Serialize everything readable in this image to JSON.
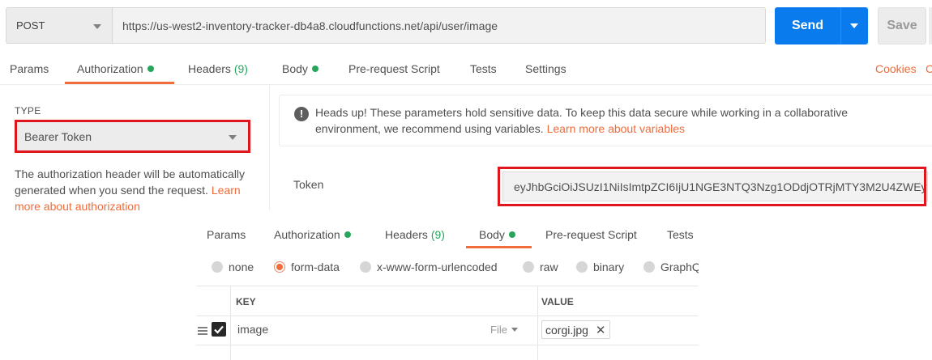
{
  "request": {
    "method": "POST",
    "url": "https://us-west2-inventory-tracker-db4a8.cloudfunctions.net/api/user/image",
    "send_label": "Send",
    "save_label": "Save"
  },
  "tabs": [
    {
      "label": "Params"
    },
    {
      "label": "Authorization",
      "dot": true,
      "active": true
    },
    {
      "label": "Headers",
      "count": "(9)"
    },
    {
      "label": "Body",
      "dot": true
    },
    {
      "label": "Pre-request Script"
    },
    {
      "label": "Tests"
    },
    {
      "label": "Settings"
    }
  ],
  "cookies_label": "Cookies",
  "cookies_cut": "C",
  "auth": {
    "type_label": "TYPE",
    "type_value": "Bearer Token",
    "description": "The authorization header will be automatically generated when you send the request.",
    "description_link": "Learn more about authorization",
    "note_text": "Heads up! These parameters hold sensitive data. To keep this data secure while working in a collaborative environment, we recommend using variables.",
    "note_link": "Learn more about variables",
    "token_label": "Token",
    "token_value": "eyJhbGciOiJSUzI1NiIsImtpZCI6IjU1NGE3NTQ3Nzg1ODdjOTRjMTY3M2U4ZWEyN..."
  },
  "body_panel": {
    "tabs": [
      {
        "label": "Params"
      },
      {
        "label": "Authorization",
        "dot": true
      },
      {
        "label": "Headers",
        "count": "(9)"
      },
      {
        "label": "Body",
        "dot": true,
        "active": true
      },
      {
        "label": "Pre-request Script"
      },
      {
        "label": "Tests"
      }
    ],
    "body_types": [
      {
        "label": "none"
      },
      {
        "label": "form-data",
        "selected": true
      },
      {
        "label": "x-www-form-urlencoded"
      },
      {
        "label": "raw"
      },
      {
        "label": "binary"
      },
      {
        "label": "GraphQ"
      }
    ],
    "headers": {
      "key": "KEY",
      "value": "VALUE"
    },
    "rows": [
      {
        "checked": true,
        "key": "image",
        "type": "File",
        "value": "corgi.jpg"
      }
    ]
  },
  "colors": {
    "accent": "#f26b3a",
    "send": "#097bed",
    "dot_green": "#26a65b",
    "highlight_red": "#e0161e"
  }
}
